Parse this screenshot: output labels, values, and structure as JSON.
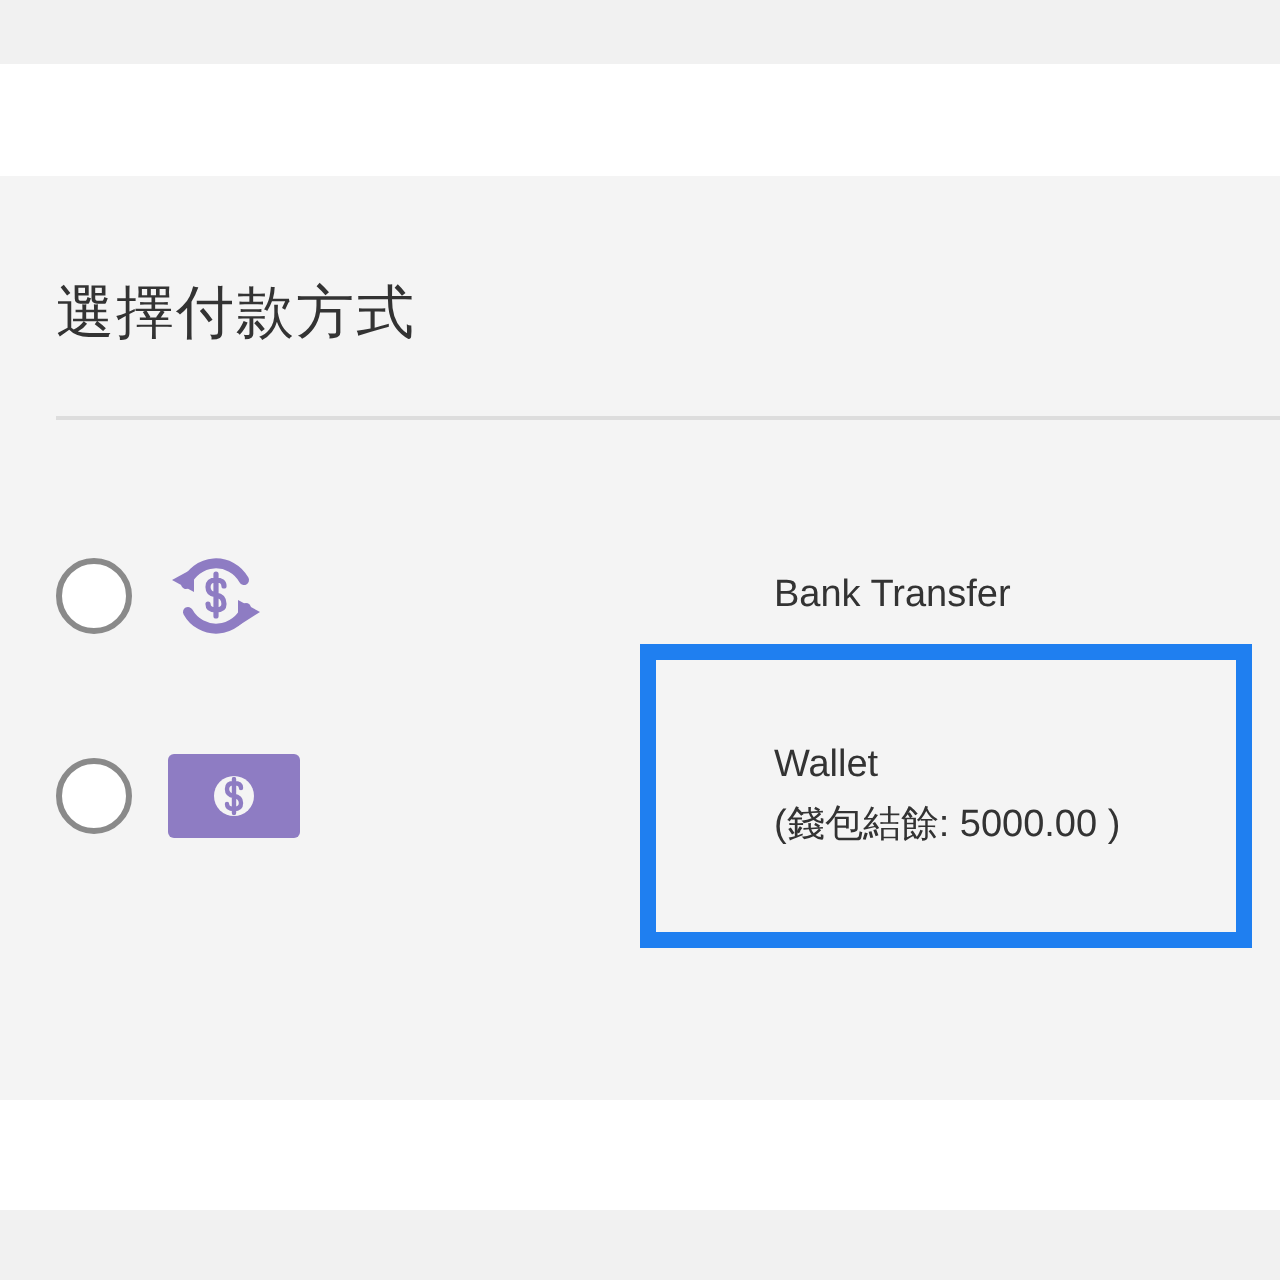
{
  "title": "選擇付款方式",
  "options": [
    {
      "kind": "exchange",
      "label": "Bank Transfer",
      "selected": false,
      "highlighted": false
    },
    {
      "kind": "cash",
      "label": "Wallet",
      "note": "(錢包結餘: 5000.00 )",
      "selected": false,
      "highlighted": true
    }
  ]
}
